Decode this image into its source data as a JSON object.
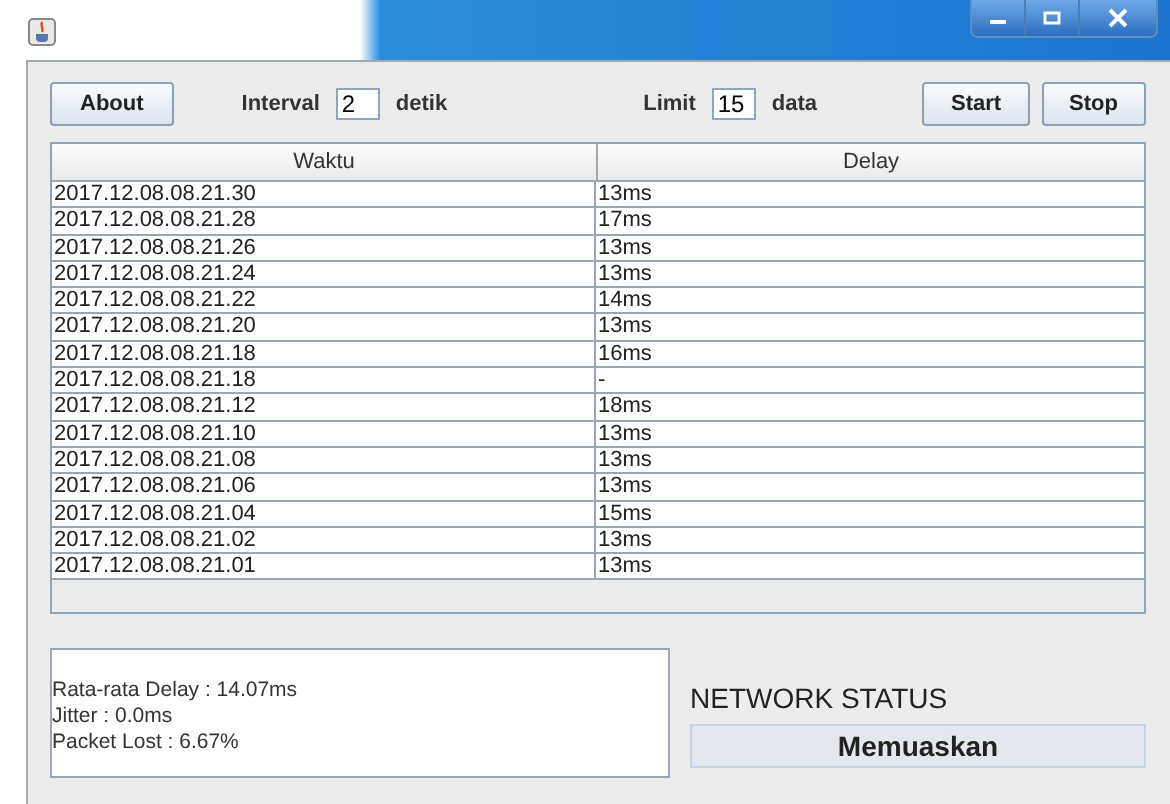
{
  "toolbar": {
    "about": "About",
    "interval_label": "Interval",
    "interval_value": "2",
    "interval_unit": "detik",
    "limit_label": "Limit",
    "limit_value": "15",
    "limit_unit": "data",
    "start": "Start",
    "stop": "Stop"
  },
  "table": {
    "columns": [
      "Waktu",
      "Delay"
    ],
    "rows": [
      [
        "2017.12.08.08.21.30",
        "13ms"
      ],
      [
        "2017.12.08.08.21.28",
        "17ms"
      ],
      [
        "2017.12.08.08.21.26",
        "13ms"
      ],
      [
        "2017.12.08.08.21.24",
        "13ms"
      ],
      [
        "2017.12.08.08.21.22",
        "14ms"
      ],
      [
        "2017.12.08.08.21.20",
        "13ms"
      ],
      [
        "2017.12.08.08.21.18",
        "16ms"
      ],
      [
        "2017.12.08.08.21.18",
        "-"
      ],
      [
        "2017.12.08.08.21.12",
        "18ms"
      ],
      [
        "2017.12.08.08.21.10",
        "13ms"
      ],
      [
        "2017.12.08.08.21.08",
        "13ms"
      ],
      [
        "2017.12.08.08.21.06",
        "13ms"
      ],
      [
        "2017.12.08.08.21.04",
        "15ms"
      ],
      [
        "2017.12.08.08.21.02",
        "13ms"
      ],
      [
        "2017.12.08.08.21.01",
        "13ms"
      ]
    ]
  },
  "stats": [
    "Rata-rata Delay : 14.07ms",
    "Jitter : 0.0ms",
    "Packet Lost : 6.67%"
  ],
  "network_status": {
    "label": "NETWORK STATUS",
    "value": "Memuaskan"
  }
}
